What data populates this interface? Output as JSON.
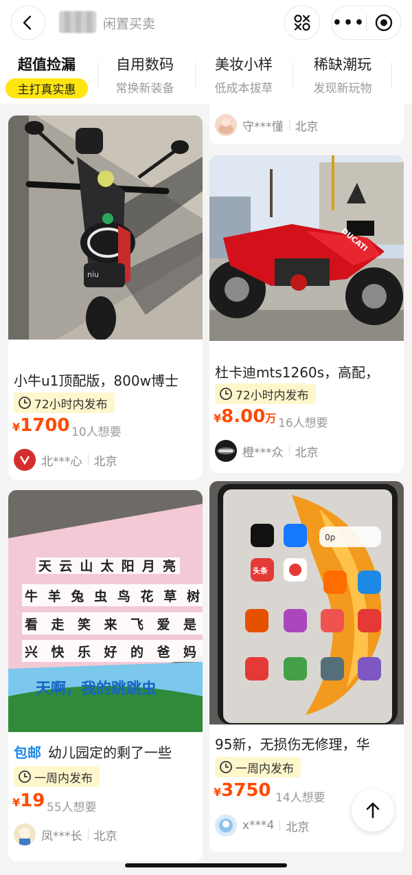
{
  "header": {
    "page_title": "闲置买卖",
    "icons": [
      "back-arrow-icon",
      "scan-icon",
      "more-dots-icon",
      "close-target-icon"
    ]
  },
  "tabs": [
    {
      "title": "超值捡漏",
      "subtitle": "主打真实惠",
      "active": true
    },
    {
      "title": "自用数码",
      "subtitle": "常换新装备"
    },
    {
      "title": "美妆小样",
      "subtitle": "低成本拔草"
    },
    {
      "title": "稀缺潮玩",
      "subtitle": "发现新玩物"
    }
  ],
  "top_seller": {
    "name": "守***懂",
    "city": "北京"
  },
  "cards": [
    {
      "title": "小牛u1顶配版，800w博士",
      "tag": "72小时内发布",
      "price_symbol": "¥",
      "price": "1700",
      "price_unit": "",
      "want": "10人想要",
      "seller": "北***心",
      "city": "北京",
      "postage": ""
    },
    {
      "title": "杜卡迪mts1260s，高配，",
      "tag": "72小时内发布",
      "price_symbol": "¥",
      "price": "8.00",
      "price_unit": "万",
      "want": "16人想要",
      "seller": "橙***众",
      "city": "北京",
      "postage": ""
    },
    {
      "title": "幼儿园定的剩了一些",
      "tag": "一周内发布",
      "price_symbol": "¥",
      "price": "19",
      "price_unit": "",
      "want": "55人想要",
      "seller": "凤***长",
      "city": "北京",
      "postage": "包邮"
    },
    {
      "title": "95新，无损伤无修理，华",
      "tag": "一周内发布",
      "price_symbol": "¥",
      "price": "3750",
      "price_unit": "",
      "want": "14人想要",
      "seller": "x***4",
      "city": "北京",
      "postage": ""
    }
  ],
  "image_text": {
    "scooter_brand": "niu",
    "moto_brand": "DUCATI",
    "book_title": "天啊，我的跳跳虫",
    "chars_row1": [
      "牛",
      "羊",
      "兔",
      "虫",
      "鸟",
      "花",
      "草",
      "树"
    ],
    "chars_row2": [
      "看",
      "走",
      "笑",
      "来",
      "飞",
      "爱",
      "是"
    ],
    "chars_row3": [
      "兴",
      "快",
      "乐",
      "好",
      "的",
      "爸",
      "妈"
    ],
    "chars_row0": [
      "天",
      "云",
      "山",
      "太",
      "阳",
      "月",
      "亮"
    ],
    "app_labels": [
      "头条",
      "0p"
    ]
  },
  "colors": {
    "accent": "#ff4a00",
    "tab_highlight": "#ffe60f",
    "tag_bg": "#fff7cc",
    "postage": "#1e88e5"
  }
}
